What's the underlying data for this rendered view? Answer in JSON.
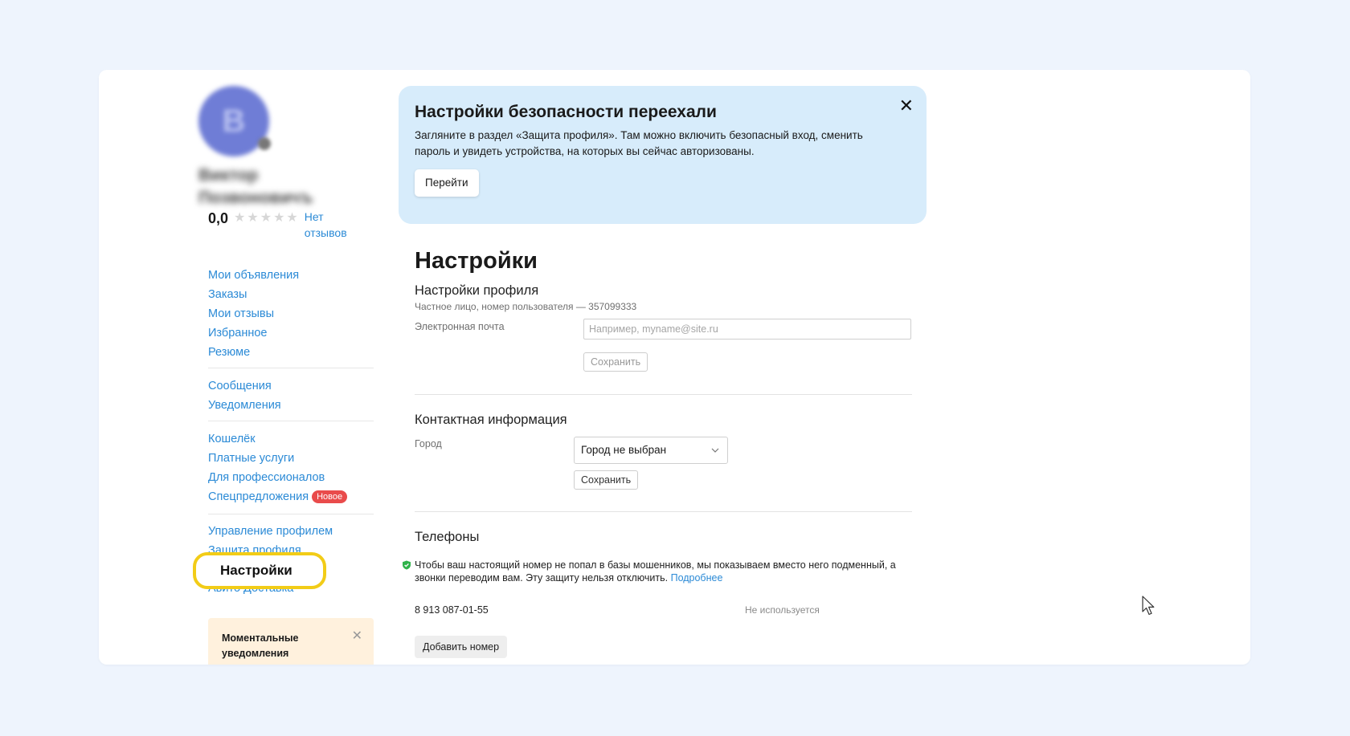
{
  "user": {
    "avatar_letter": "В",
    "name": "Виктор Позвоновичъ",
    "rating": "0,0",
    "stars": [
      "★",
      "★",
      "★",
      "★",
      "★"
    ],
    "reviews_link": "Нет отзывов"
  },
  "sidebar": {
    "group1": [
      "Мои объявления",
      "Заказы",
      "Мои отзывы",
      "Избранное",
      "Резюме"
    ],
    "group2": [
      "Сообщения",
      "Уведомления"
    ],
    "group3": [
      "Кошелёк",
      "Платные услуги",
      "Для профессионалов"
    ],
    "special_offers": "Спецпредложения",
    "badge_new": "Новое",
    "group4": [
      "Управление профилем",
      "Защита профиля"
    ],
    "active_item": "Настройки",
    "after_active": "Авито Доставка",
    "promo_title": "Моментальные уведомления",
    "promo_close": "✕"
  },
  "banner": {
    "title": "Настройки безопасности переехали",
    "text": "Загляните в раздел «Защита профиля». Там можно включить безопасный вход, сменить пароль и увидеть устройства, на которых вы сейчас авторизованы.",
    "button": "Перейти",
    "close": "✕"
  },
  "main": {
    "title": "Настройки",
    "profile": {
      "title": "Настройки профиля",
      "subtitle": "Частное лицо, номер пользователя — 357099333",
      "email_label": "Электронная почта",
      "email_placeholder": "Например, myname@site.ru",
      "email_value": "",
      "save": "Сохранить"
    },
    "contact": {
      "title": "Контактная информация",
      "city_label": "Город",
      "city_value": "Город не выбран",
      "save": "Сохранить"
    },
    "phones": {
      "title": "Телефоны",
      "note": "Чтобы ваш настоящий номер не попал в базы мошенников, мы показываем вместо него подменный, а звонки переводим вам. Эту защиту нельзя отключить.",
      "more_link": "Подробнее",
      "number": "8 913 087-01-55",
      "status": "Не используется",
      "add": "Добавить номер"
    }
  },
  "colors": {
    "link": "#2b8ad6",
    "banner_bg": "#d7ecfb",
    "highlight": "#f2cc17",
    "badge": "#e94b4b",
    "shield": "#2fb34a"
  }
}
